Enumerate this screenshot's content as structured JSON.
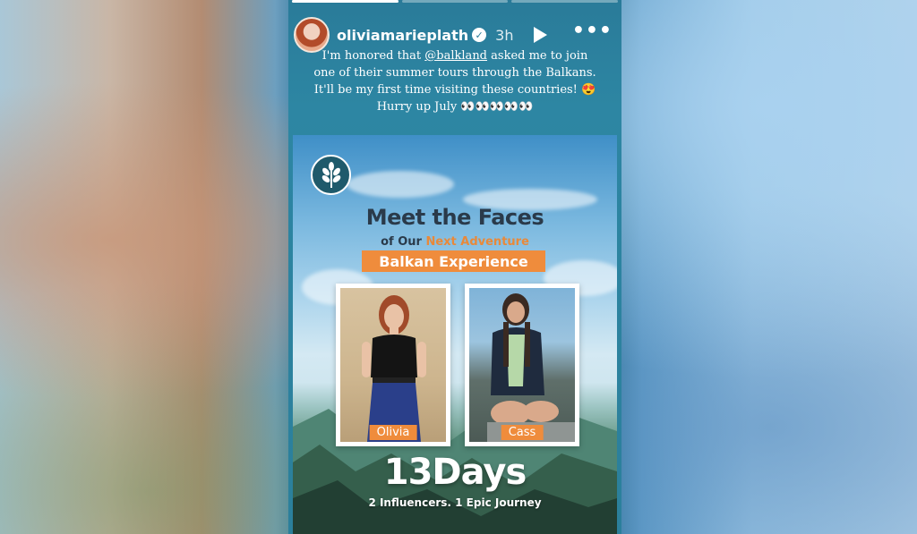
{
  "story": {
    "progress": [
      1,
      0,
      0
    ],
    "username": "oliviamarieplath",
    "verified_icon": "verified-check-icon",
    "time": "3h",
    "caption_before": "I'm honored that ",
    "mention": "@balkland",
    "caption_after": " asked me to join one of their summer tours through the Balkans.  It'll be my first time visiting these countries! 😍 Hurry up July 👀👀👀👀👀",
    "controls": {
      "play_icon": "play-icon",
      "more_icon": "more-options-icon"
    }
  },
  "post": {
    "logo_icon": "leaf-logo-icon",
    "title_line1": "Meet the Faces",
    "title_line2_prefix": "of Our ",
    "title_line2_accent": "Next Adventure",
    "badge": "Balkan Experience",
    "photos": [
      {
        "label": "Olivia"
      },
      {
        "label": "Cass"
      }
    ],
    "days": "13Days",
    "tagline": "2 Influencers. 1 Epic Journey"
  },
  "colors": {
    "story_bg": "#2a7b99",
    "accent_orange": "#ef8c3c",
    "title_dark": "#2a3a4a"
  }
}
